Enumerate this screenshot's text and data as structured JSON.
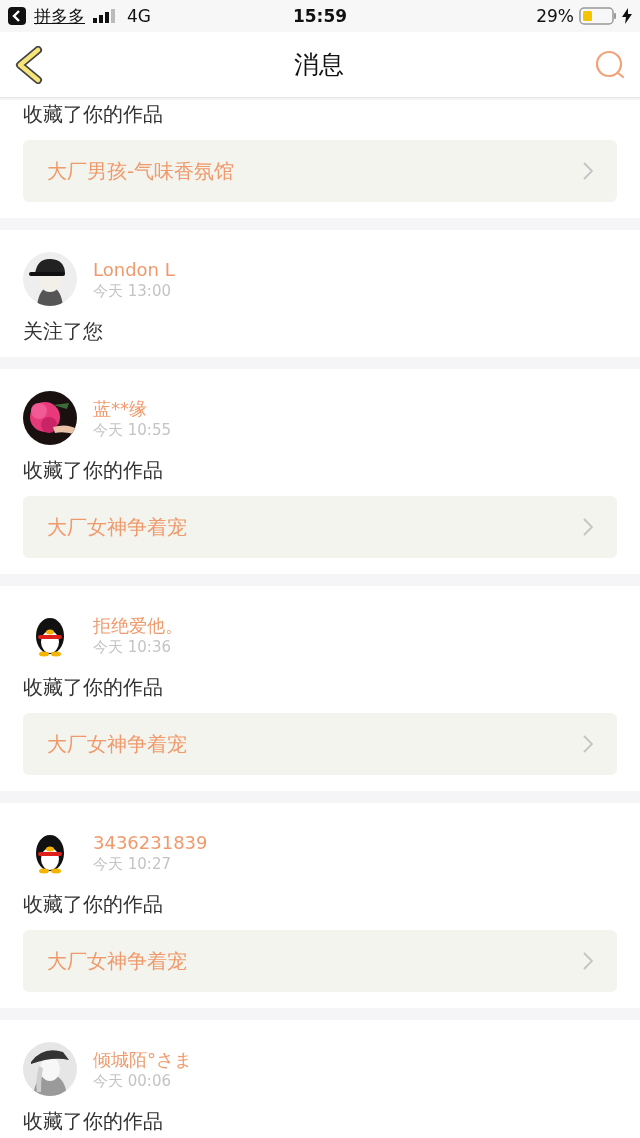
{
  "status_bar": {
    "back_app": "拼多多",
    "carrier": "4G",
    "time": "15:59",
    "battery": "29%"
  },
  "nav": {
    "title": "消息"
  },
  "messages": [
    {
      "action": "收藏了你的作品",
      "work": "大厂男孩-气味香氛馆"
    },
    {
      "user": {
        "name": "London L"
      },
      "time": "今天 13:00",
      "action": "关注了您"
    },
    {
      "user": {
        "name": "蓝**缘"
      },
      "time": "今天 10:55",
      "action": "收藏了你的作品",
      "work": "大厂女神争着宠"
    },
    {
      "user": {
        "name": "拒绝爱他。",
        "avatar": {
          "kind": "default"
        }
      },
      "time": "今天 10:36",
      "action": "收藏了你的作品",
      "work": "大厂女神争着宠"
    },
    {
      "user": {
        "name": "3436231839",
        "avatar": {
          "kind": "default"
        }
      },
      "time": "今天 10:27",
      "action": "收藏了你的作品",
      "work": "大厂女神争着宠"
    },
    {
      "user": {
        "name": "倾城陌°さま"
      },
      "time": "今天 00:06",
      "action": "收藏了你的作品"
    }
  ]
}
